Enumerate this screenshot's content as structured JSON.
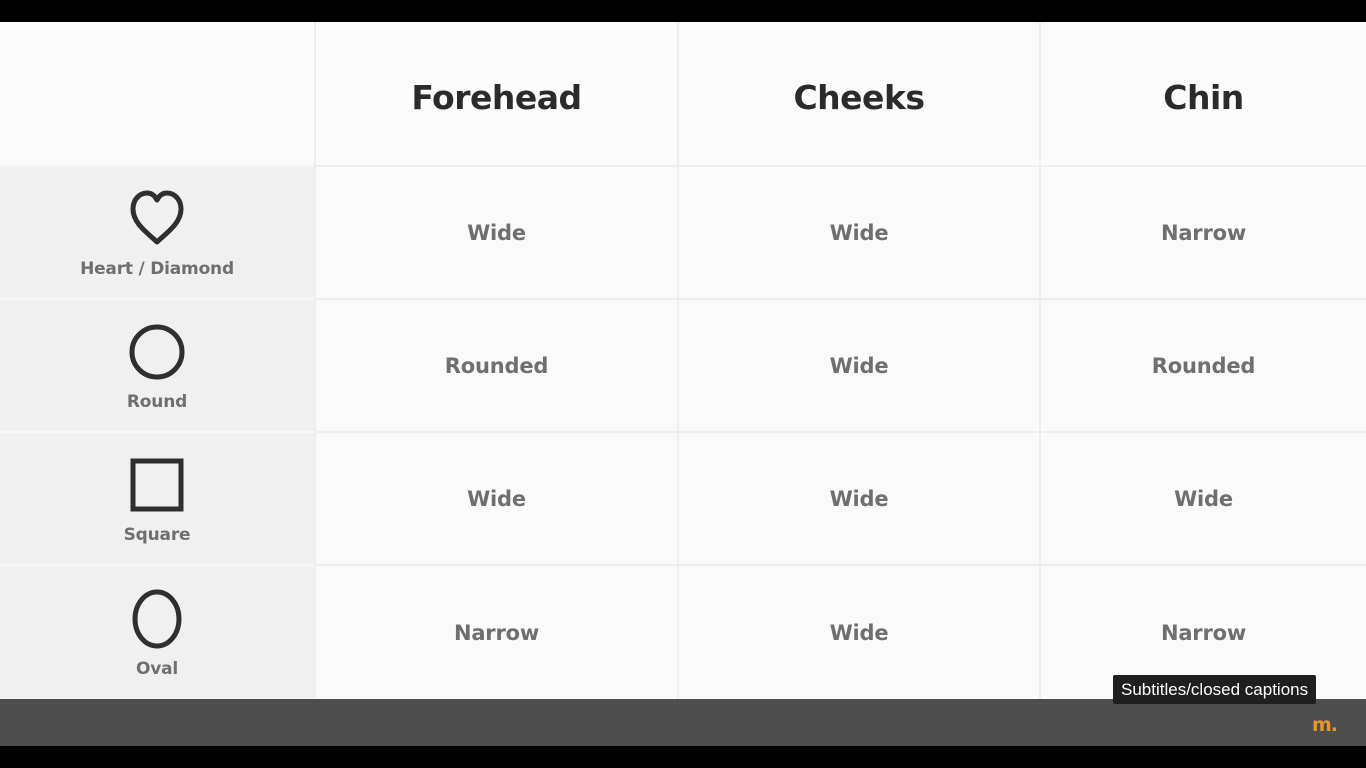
{
  "table": {
    "columns": [
      "Forehead",
      "Cheeks",
      "Chin"
    ],
    "rows": [
      {
        "shape": "Heart / Diamond",
        "icon": "heart-icon",
        "values": [
          "Wide",
          "Wide",
          "Narrow"
        ]
      },
      {
        "shape": "Round",
        "icon": "circle-icon",
        "values": [
          "Rounded",
          "Wide",
          "Rounded"
        ]
      },
      {
        "shape": "Square",
        "icon": "square-icon",
        "values": [
          "Wide",
          "Wide",
          "Wide"
        ]
      },
      {
        "shape": "Oval",
        "icon": "oval-icon",
        "values": [
          "Narrow",
          "Wide",
          "Narrow"
        ]
      }
    ]
  },
  "player": {
    "tooltip": "Subtitles/closed captions",
    "logo": "m."
  },
  "colors": {
    "header_text": "#2b2b2b",
    "cell_text": "#6f6f6f",
    "icon_stroke": "#2f2f2f",
    "control_bar": "#4e4e4e",
    "brand": "#e8962a"
  }
}
